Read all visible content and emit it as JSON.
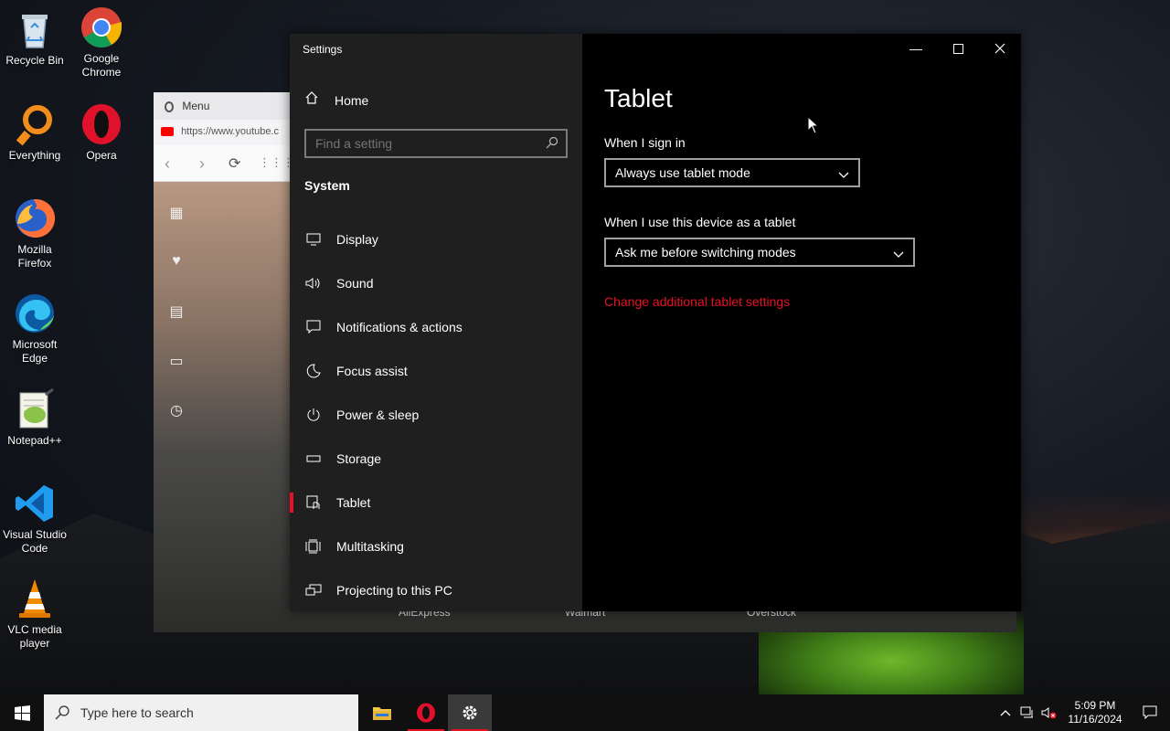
{
  "desktop": {
    "icons": [
      {
        "label_1": "Recycle Bin",
        "label_2": ""
      },
      {
        "label_1": "Google",
        "label_2": "Chrome"
      },
      {
        "label_1": "Everything",
        "label_2": ""
      },
      {
        "label_1": "Opera",
        "label_2": ""
      },
      {
        "label_1": "Mozilla",
        "label_2": "Firefox"
      },
      {
        "label_1": "Microsoft",
        "label_2": "Edge"
      },
      {
        "label_1": "Notepad++",
        "label_2": ""
      },
      {
        "label_1": "Visual Studio",
        "label_2": "Code"
      },
      {
        "label_1": "VLC media",
        "label_2": "player"
      }
    ]
  },
  "opera": {
    "menu_label": "Menu",
    "tab_url": "https://www.youtube.c",
    "shortcuts": [
      "AliExpress",
      "Walmart",
      "Overstock"
    ]
  },
  "settings": {
    "window_title": "Settings",
    "home_label": "Home",
    "search_placeholder": "Find a setting",
    "section": "System",
    "nav": [
      {
        "label": "Display",
        "icon": "display-icon"
      },
      {
        "label": "Sound",
        "icon": "sound-icon"
      },
      {
        "label": "Notifications & actions",
        "icon": "notifications-icon"
      },
      {
        "label": "Focus assist",
        "icon": "moon-icon"
      },
      {
        "label": "Power & sleep",
        "icon": "power-icon"
      },
      {
        "label": "Storage",
        "icon": "storage-icon"
      },
      {
        "label": "Tablet",
        "icon": "tablet-icon"
      },
      {
        "label": "Multitasking",
        "icon": "multitasking-icon"
      },
      {
        "label": "Projecting to this PC",
        "icon": "projecting-icon"
      }
    ],
    "active_nav": "Tablet",
    "page": {
      "title": "Tablet",
      "sign_in_label": "When I sign in",
      "sign_in_value": "Always use tablet mode",
      "device_label": "When I use this device as a tablet",
      "device_value": "Ask me before switching modes",
      "link_text": "Change additional tablet settings"
    },
    "accent_color": "#e81123"
  },
  "taskbar": {
    "search_placeholder": "Type here to search",
    "time": "5:09 PM",
    "date": "11/16/2024"
  }
}
